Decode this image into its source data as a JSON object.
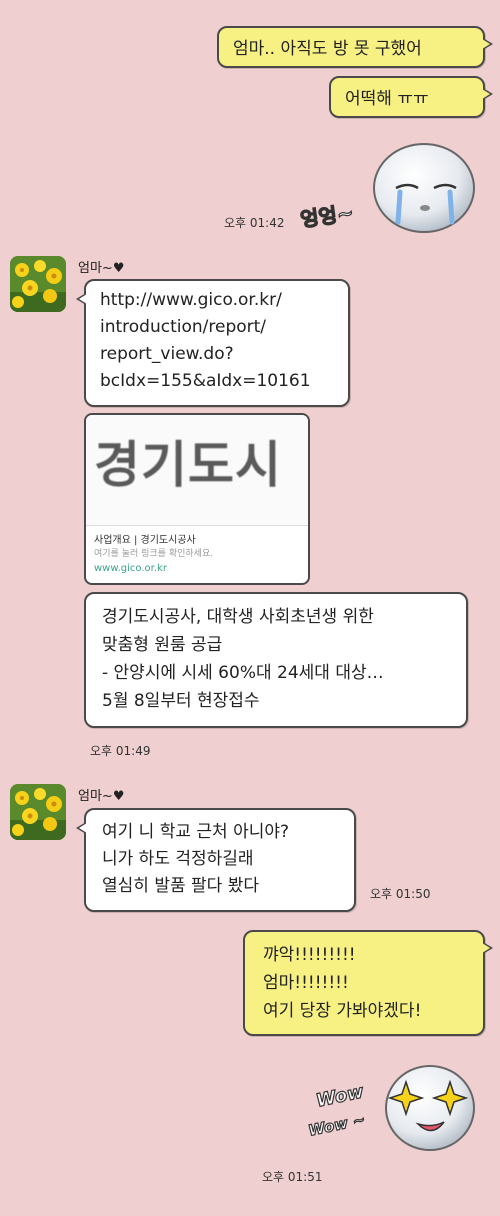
{
  "messages_top": {
    "me_1": "엄마.. 아직도 방 못 구했어",
    "me_2": "어떡해 ㅠㅠ",
    "sticker_cry_text": "엉엉~",
    "time_1": "오후 01:42"
  },
  "sender": {
    "name": "엄마~♥"
  },
  "group_1": {
    "link_lines": [
      "http://www.gico.or.kr/",
      "introduction/report/",
      "report_view.do?",
      "bcIdx=155&aIdx=10161"
    ],
    "card": {
      "big_text": "경기도시",
      "line1": "사업개요 | 경기도시공사",
      "line2": "여기를 눌러 링크를 확인하세요.",
      "line3": "www.gico.or.kr"
    },
    "article_lines": [
      "경기도시공사, 대학생 사회초년생 위한",
      "맞춤형 원룸 공급",
      "- 안양시에 시세 60%대 24세대 대상…",
      "5월 8일부터 현장접수"
    ],
    "time": "오후 01:49"
  },
  "group_2": {
    "lines": [
      "여기 니 학교 근처 아니야?",
      "니가 하도 걱정하길래",
      "열심히 발품 팔다 봤다"
    ],
    "time": "오후 01:50"
  },
  "me_reply": {
    "lines": [
      "꺄악!!!!!!!!!",
      "엄마!!!!!!!!",
      "여기 당장 가봐야겠다!"
    ]
  },
  "sticker_wow": {
    "text_1": "Wow",
    "text_2": "Wow ~"
  },
  "time_last": "오후 01:51",
  "colors": {
    "background": "#efcfcf",
    "my_bubble": "#f7f083",
    "other_bubble": "#ffffff",
    "link_green": "#3aa38a"
  }
}
